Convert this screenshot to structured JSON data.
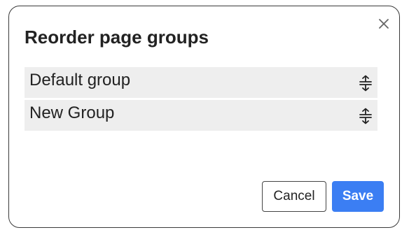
{
  "dialog": {
    "title": "Reorder page groups",
    "close_icon": "close-icon",
    "groups": [
      {
        "label": "Default group",
        "handle_icon": "drag-handle-icon"
      },
      {
        "label": "New Group",
        "handle_icon": "drag-handle-icon"
      }
    ],
    "cancel_label": "Cancel",
    "save_label": "Save",
    "colors": {
      "primary": "#3b7ef3",
      "item_background": "#eeeeee",
      "border": "#3a3a3a"
    }
  }
}
